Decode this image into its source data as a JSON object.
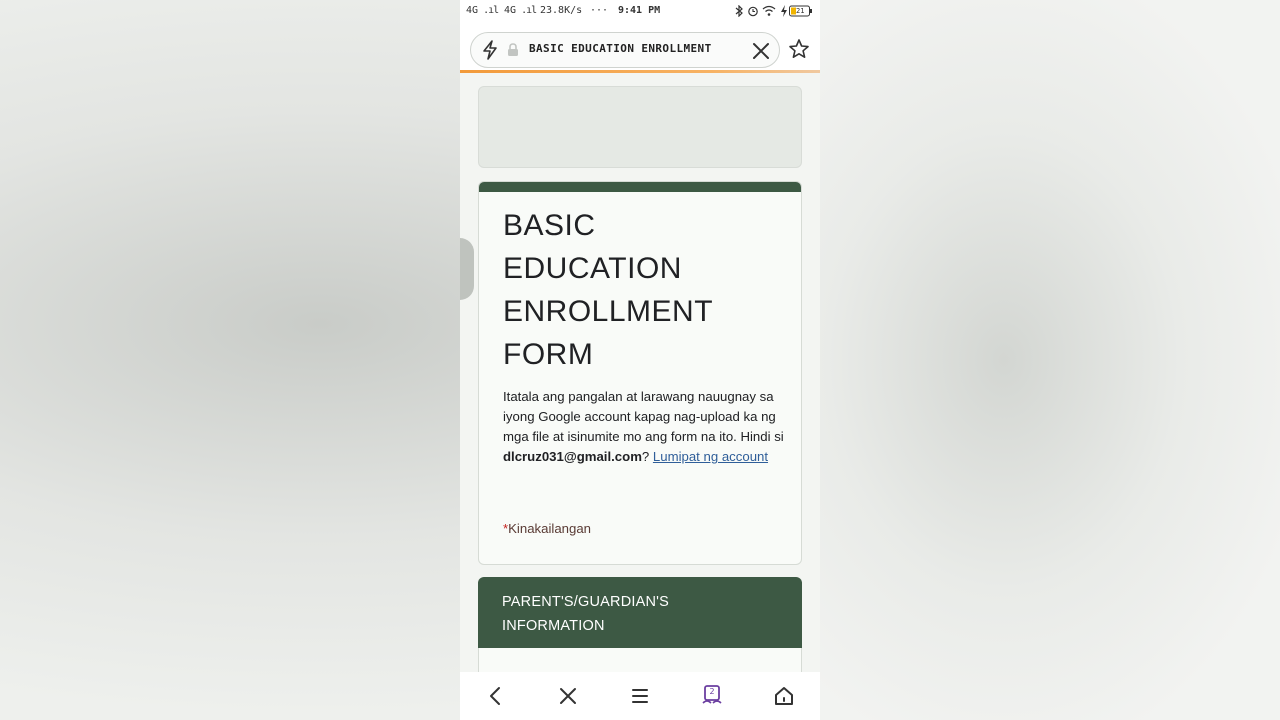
{
  "status_bar": {
    "network": "4G",
    "network2": "4G",
    "speed": "23.8K/s",
    "dots": "···",
    "time": "9:41 PM",
    "battery": "21"
  },
  "browser": {
    "page_title": "BASIC EDUCATION ENROLLMENT",
    "tab_count": "2"
  },
  "form": {
    "title": "BASIC EDUCATION ENROLLMENT FORM",
    "description": "Itatala ang pangalan at larawang nauugnay sa iyong Google account kapag nag-upload ka ng mga file at isinumite mo ang form na ito. Hindi si ",
    "email": "dlcruz031@gmail.com",
    "question_mark": "? ",
    "switch_account": "Lumipat ng account",
    "required_star": "*",
    "required_text": "Kinakailangan"
  },
  "section": {
    "title": "PARENT'S/GUARDIAN'S INFORMATION"
  },
  "colors": {
    "header_green": "#3d5944",
    "required_red": "#c5221f",
    "link_blue": "#2f5e99",
    "progress_orange": "#f29a3a"
  },
  "icons": [
    "bolt-icon",
    "lock-icon",
    "close-icon",
    "star-icon",
    "back-icon",
    "close-tab-icon",
    "menu-icon",
    "tabs-icon",
    "home-icon"
  ]
}
